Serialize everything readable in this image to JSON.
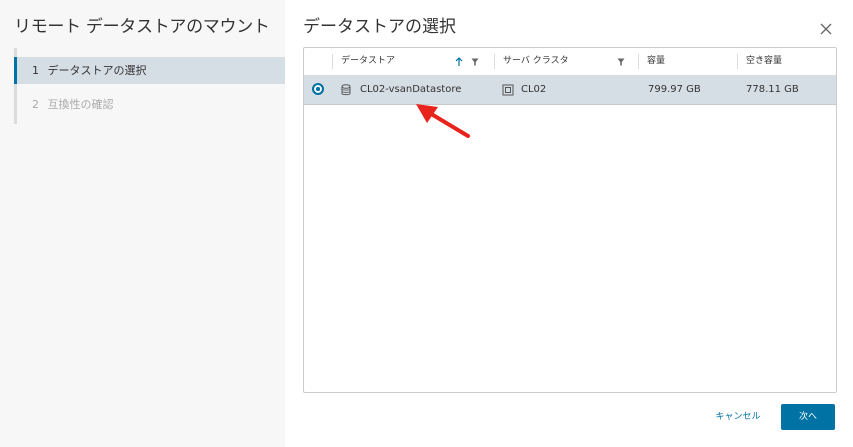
{
  "wizard": {
    "title": "リモート データストアのマウント",
    "steps": [
      {
        "number": "1",
        "label": "データストアの選択",
        "state": "active"
      },
      {
        "number": "2",
        "label": "互換性の確認",
        "state": "inactive"
      }
    ]
  },
  "dialog": {
    "title": "データストアの選択",
    "close_icon": "close-icon"
  },
  "grid": {
    "columns": [
      {
        "label": "データストア",
        "sort_icon": "sort-ascending-icon",
        "filter_icon": "filter-icon"
      },
      {
        "label": "サーバ クラスタ",
        "filter_icon": "filter-icon"
      },
      {
        "label": "容量"
      },
      {
        "label": "空き容量"
      }
    ],
    "rows": [
      {
        "selected": true,
        "datastore": "CL02-vsanDatastore",
        "datastore_icon": "datastore-icon",
        "cluster": "CL02",
        "cluster_icon": "cluster-icon",
        "capacity": "799.97 GB",
        "free": "778.11 GB"
      }
    ]
  },
  "footer": {
    "cancel_label": "キャンセル",
    "next_label": "次へ"
  },
  "colors": {
    "accent": "#0072a3",
    "selected_row": "#d5dde5",
    "annotation_arrow": "#e8231b"
  }
}
